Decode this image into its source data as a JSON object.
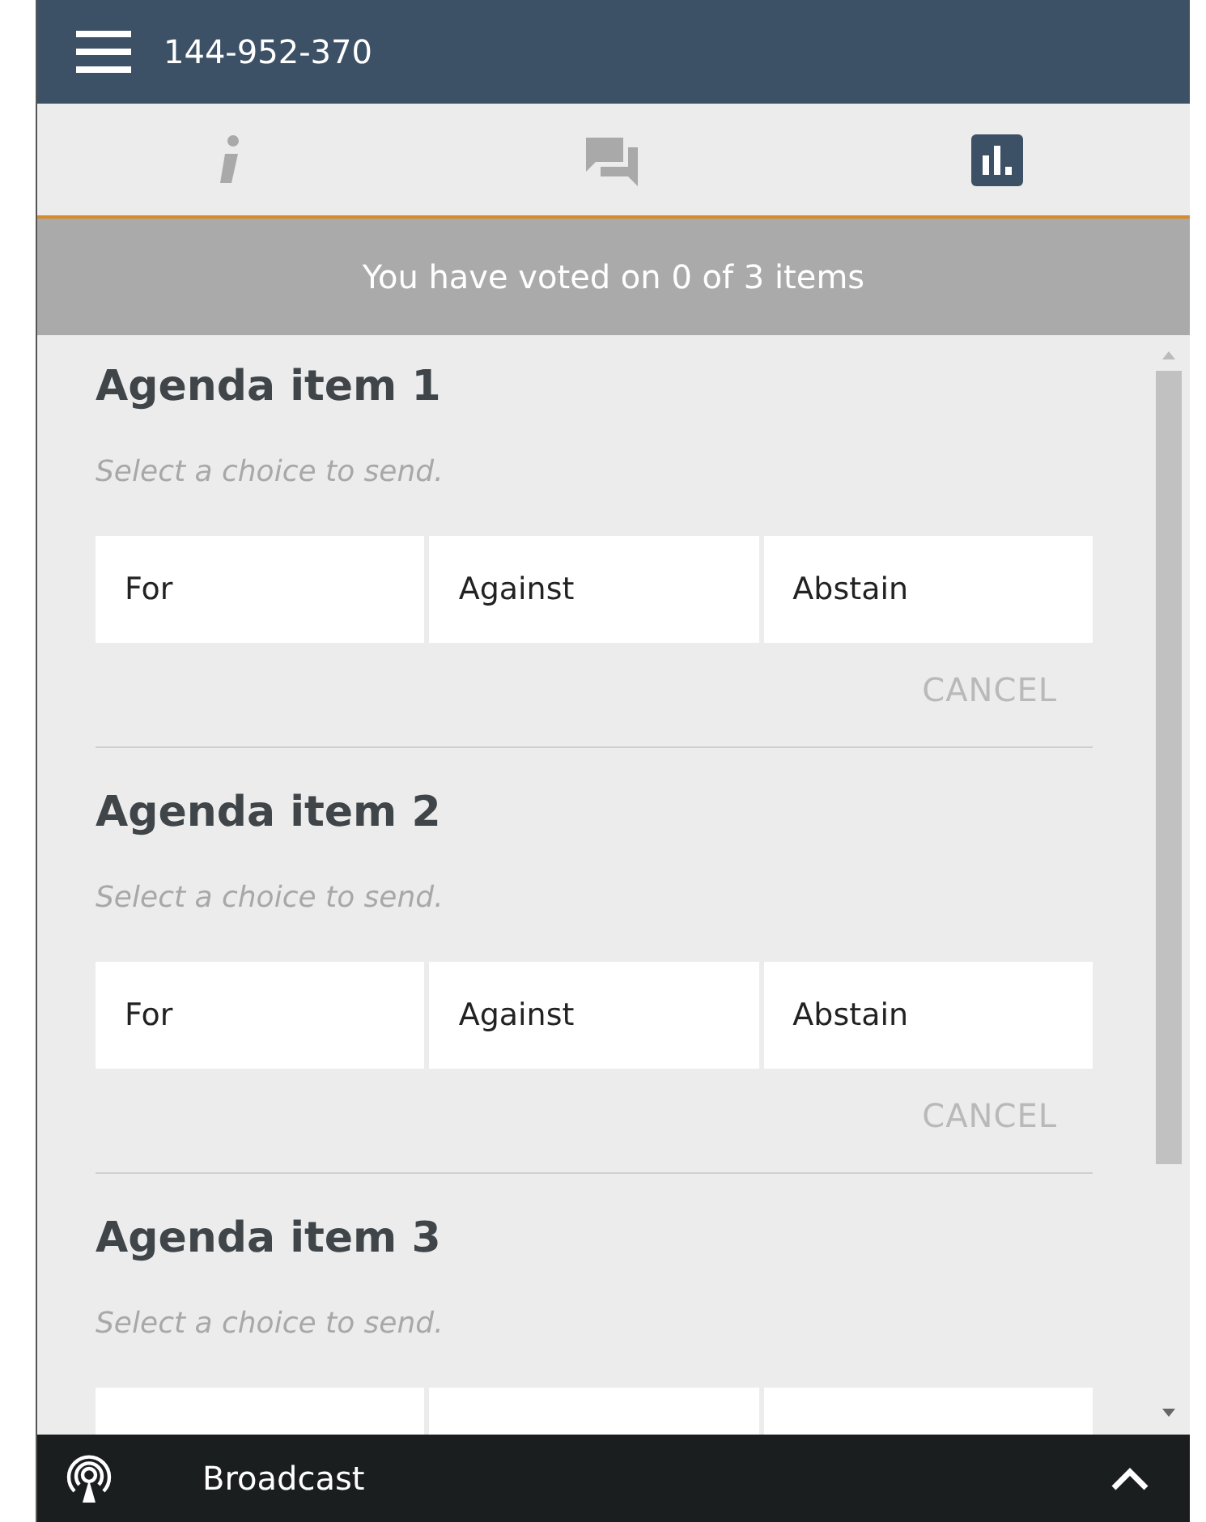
{
  "header": {
    "title": "144-952-370"
  },
  "tabs": [
    {
      "kind": "info",
      "selected": false
    },
    {
      "kind": "chat",
      "selected": false
    },
    {
      "kind": "polls",
      "selected": true
    }
  ],
  "status": "You have voted on 0 of 3 items",
  "agenda_items": [
    {
      "title": "Agenda item 1",
      "hint": "Select a choice to send.",
      "choices": [
        "For",
        "Against",
        "Abstain"
      ],
      "cancel": "CANCEL"
    },
    {
      "title": "Agenda item 2",
      "hint": "Select a choice to send.",
      "choices": [
        "For",
        "Against",
        "Abstain"
      ],
      "cancel": "CANCEL"
    },
    {
      "title": "Agenda item 3",
      "hint": "Select a choice to send.",
      "choices": [
        {
          "kind": "cut_off"
        },
        {
          "kind": "cut_off"
        },
        {
          "kind": "cut_off"
        }
      ]
    }
  ],
  "bottom_bar": {
    "label": "Broadcast"
  }
}
